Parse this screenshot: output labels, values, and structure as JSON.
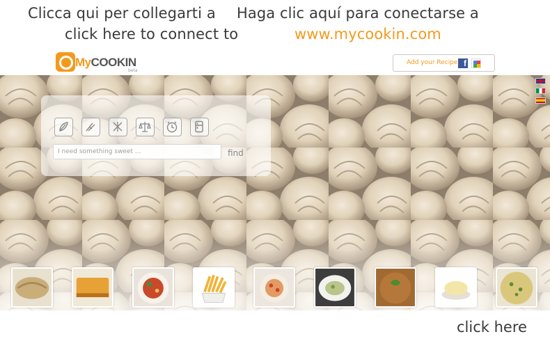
{
  "messages": {
    "italian_line": "Clicca qui per collegarti a",
    "spanish_line": "Haga clic aquí para conectarse a",
    "english_line": "click here to connect to",
    "url": "www.mycookin.com"
  },
  "header": {
    "logo_text_my": "My",
    "logo_text_cookin": "COOKIN",
    "logo_tagline": "beta",
    "add_recipe_label": "Add your Recipe",
    "facebook_icon": "facebook-icon",
    "google_icon": "google-icon"
  },
  "search": {
    "placeholder": "I need something sweet ...",
    "find_label": "find",
    "filter_icons": [
      "vegetarian-icon",
      "light-icon",
      "no-icon",
      "price-scale-icon",
      "time-clock-icon",
      "fridge-icon"
    ]
  },
  "languages": [
    "english-flag-icon",
    "italian-flag-icon",
    "spanish-flag-icon"
  ],
  "footer": {
    "click_here": "click here"
  },
  "colors": {
    "brand_orange": "#f39a1d",
    "text_dark": "#3a3a3a"
  }
}
